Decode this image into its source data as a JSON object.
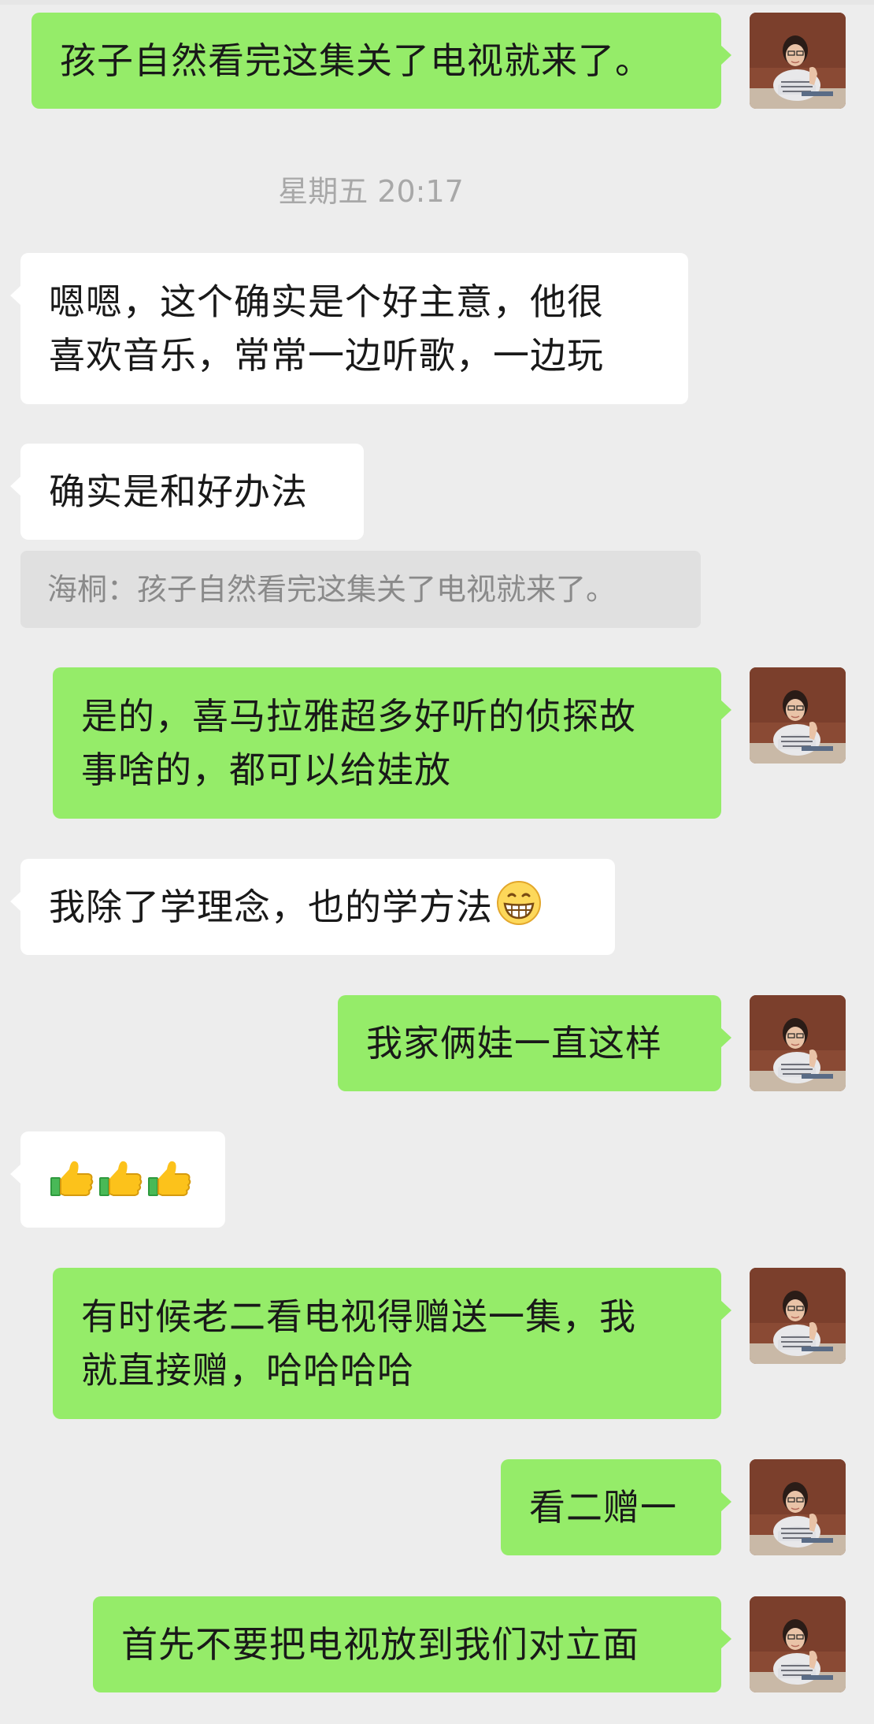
{
  "messages": {
    "m1": "孩子自然看完这集关了电视就来了。",
    "timestamp": "星期五 20:17",
    "m2_line1": "嗯嗯，这个确实是个好主意，他很",
    "m2_line2": "喜欢音乐，常常一边听歌，一边玩",
    "m3": "确实是和好办法",
    "quote": "海桐：孩子自然看完这集关了电视就来了。",
    "m4_line1": "是的，喜马拉雅超多好听的侦探故",
    "m4_line2": "事啥的，都可以给娃放",
    "m5": "我除了学理念，也的学方法",
    "m6": "我家俩娃一直这样",
    "m8_line1": "有时候老二看电视得赠送一集，我",
    "m8_line2": "就直接赠，哈哈哈哈",
    "m9": "看二赠一",
    "m10": "首先不要把电视放到我们对立面"
  },
  "icons": {
    "avatar": "user-avatar-icon",
    "grin": "grinning-face-emoji-icon",
    "thumb": "thumbs-up-emoji-icon"
  },
  "colors": {
    "outgoing_bubble": "#95ec69",
    "incoming_bubble": "#ffffff",
    "background": "#ededed"
  }
}
